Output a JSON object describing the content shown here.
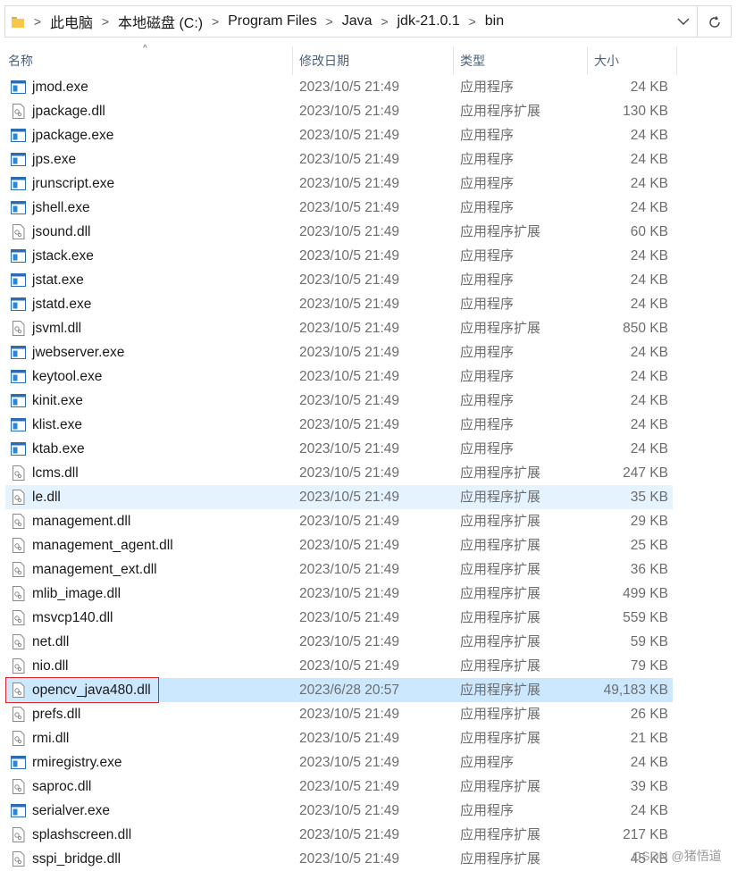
{
  "address_bar": {
    "breadcrumbs": [
      "此电脑",
      "本地磁盘 (C:)",
      "Program Files",
      "Java",
      "jdk-21.0.1",
      "bin"
    ],
    "separator": ">"
  },
  "columns": {
    "name": "名称",
    "date": "修改日期",
    "type": "类型",
    "size": "大小"
  },
  "files": [
    {
      "name": "jmod.exe",
      "date": "2023/10/5 21:49",
      "type": "应用程序",
      "size": "24 KB",
      "icon": "exe-icon"
    },
    {
      "name": "jpackage.dll",
      "date": "2023/10/5 21:49",
      "type": "应用程序扩展",
      "size": "130 KB",
      "icon": "dll-icon"
    },
    {
      "name": "jpackage.exe",
      "date": "2023/10/5 21:49",
      "type": "应用程序",
      "size": "24 KB",
      "icon": "exe-icon"
    },
    {
      "name": "jps.exe",
      "date": "2023/10/5 21:49",
      "type": "应用程序",
      "size": "24 KB",
      "icon": "exe-icon"
    },
    {
      "name": "jrunscript.exe",
      "date": "2023/10/5 21:49",
      "type": "应用程序",
      "size": "24 KB",
      "icon": "exe-icon"
    },
    {
      "name": "jshell.exe",
      "date": "2023/10/5 21:49",
      "type": "应用程序",
      "size": "24 KB",
      "icon": "exe-icon"
    },
    {
      "name": "jsound.dll",
      "date": "2023/10/5 21:49",
      "type": "应用程序扩展",
      "size": "60 KB",
      "icon": "dll-icon"
    },
    {
      "name": "jstack.exe",
      "date": "2023/10/5 21:49",
      "type": "应用程序",
      "size": "24 KB",
      "icon": "exe-icon"
    },
    {
      "name": "jstat.exe",
      "date": "2023/10/5 21:49",
      "type": "应用程序",
      "size": "24 KB",
      "icon": "exe-icon"
    },
    {
      "name": "jstatd.exe",
      "date": "2023/10/5 21:49",
      "type": "应用程序",
      "size": "24 KB",
      "icon": "exe-icon"
    },
    {
      "name": "jsvml.dll",
      "date": "2023/10/5 21:49",
      "type": "应用程序扩展",
      "size": "850 KB",
      "icon": "dll-icon"
    },
    {
      "name": "jwebserver.exe",
      "date": "2023/10/5 21:49",
      "type": "应用程序",
      "size": "24 KB",
      "icon": "exe-icon"
    },
    {
      "name": "keytool.exe",
      "date": "2023/10/5 21:49",
      "type": "应用程序",
      "size": "24 KB",
      "icon": "exe-icon"
    },
    {
      "name": "kinit.exe",
      "date": "2023/10/5 21:49",
      "type": "应用程序",
      "size": "24 KB",
      "icon": "exe-icon"
    },
    {
      "name": "klist.exe",
      "date": "2023/10/5 21:49",
      "type": "应用程序",
      "size": "24 KB",
      "icon": "exe-icon"
    },
    {
      "name": "ktab.exe",
      "date": "2023/10/5 21:49",
      "type": "应用程序",
      "size": "24 KB",
      "icon": "exe-icon"
    },
    {
      "name": "lcms.dll",
      "date": "2023/10/5 21:49",
      "type": "应用程序扩展",
      "size": "247 KB",
      "icon": "dll-icon"
    },
    {
      "name": "le.dll",
      "date": "2023/10/5 21:49",
      "type": "应用程序扩展",
      "size": "35 KB",
      "icon": "dll-icon",
      "state": "hover"
    },
    {
      "name": "management.dll",
      "date": "2023/10/5 21:49",
      "type": "应用程序扩展",
      "size": "29 KB",
      "icon": "dll-icon"
    },
    {
      "name": "management_agent.dll",
      "date": "2023/10/5 21:49",
      "type": "应用程序扩展",
      "size": "25 KB",
      "icon": "dll-icon"
    },
    {
      "name": "management_ext.dll",
      "date": "2023/10/5 21:49",
      "type": "应用程序扩展",
      "size": "36 KB",
      "icon": "dll-icon"
    },
    {
      "name": "mlib_image.dll",
      "date": "2023/10/5 21:49",
      "type": "应用程序扩展",
      "size": "499 KB",
      "icon": "dll-icon"
    },
    {
      "name": "msvcp140.dll",
      "date": "2023/10/5 21:49",
      "type": "应用程序扩展",
      "size": "559 KB",
      "icon": "dll-icon"
    },
    {
      "name": "net.dll",
      "date": "2023/10/5 21:49",
      "type": "应用程序扩展",
      "size": "59 KB",
      "icon": "dll-icon"
    },
    {
      "name": "nio.dll",
      "date": "2023/10/5 21:49",
      "type": "应用程序扩展",
      "size": "79 KB",
      "icon": "dll-icon"
    },
    {
      "name": "opencv_java480.dll",
      "date": "2023/6/28 20:57",
      "type": "应用程序扩展",
      "size": "49,183 KB",
      "icon": "dll-icon",
      "state": "selected",
      "highlight": true
    },
    {
      "name": "prefs.dll",
      "date": "2023/10/5 21:49",
      "type": "应用程序扩展",
      "size": "26 KB",
      "icon": "dll-icon"
    },
    {
      "name": "rmi.dll",
      "date": "2023/10/5 21:49",
      "type": "应用程序扩展",
      "size": "21 KB",
      "icon": "dll-icon"
    },
    {
      "name": "rmiregistry.exe",
      "date": "2023/10/5 21:49",
      "type": "应用程序",
      "size": "24 KB",
      "icon": "exe-icon"
    },
    {
      "name": "saproc.dll",
      "date": "2023/10/5 21:49",
      "type": "应用程序扩展",
      "size": "39 KB",
      "icon": "dll-icon"
    },
    {
      "name": "serialver.exe",
      "date": "2023/10/5 21:49",
      "type": "应用程序",
      "size": "24 KB",
      "icon": "exe-icon"
    },
    {
      "name": "splashscreen.dll",
      "date": "2023/10/5 21:49",
      "type": "应用程序扩展",
      "size": "217 KB",
      "icon": "dll-icon"
    },
    {
      "name": "sspi_bridge.dll",
      "date": "2023/10/5 21:49",
      "type": "应用程序扩展",
      "size": "45 KB",
      "icon": "dll-icon"
    }
  ],
  "colors": {
    "hover_row": "#e5f3ff",
    "selected_row": "#cce8ff",
    "highlight_box": "#d9252a",
    "header_text": "#4c607a"
  },
  "watermark": "CSDN @猪悟道"
}
